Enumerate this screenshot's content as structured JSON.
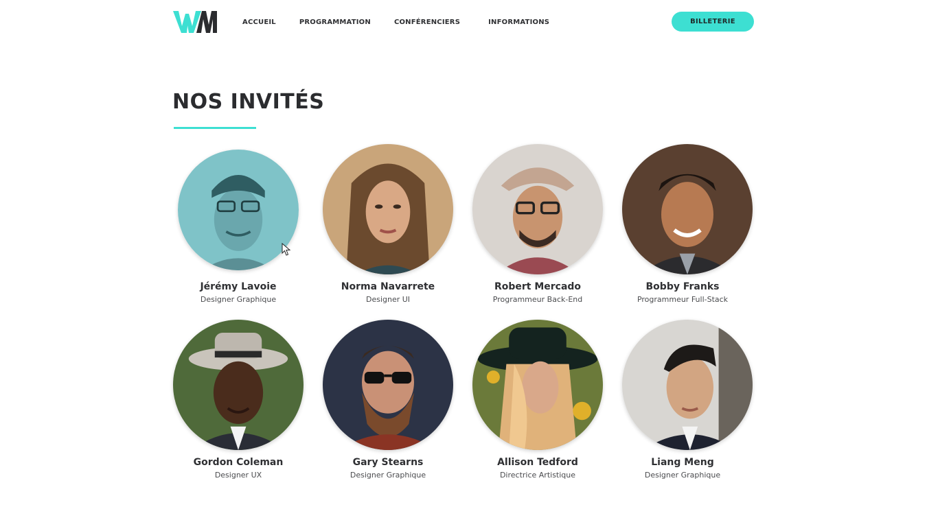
{
  "header": {
    "logo_text": "WM",
    "nav": [
      "ACCUEIL",
      "PROGRAMMATION",
      "CONFÉRENCIERS",
      "INFORMATIONS"
    ],
    "ticket_label": "BILLETERIE"
  },
  "section": {
    "title": "NOS INVITÉS"
  },
  "colors": {
    "accent": "#3ddfd2",
    "text": "#2f3033",
    "logo_dark": "#2b2c2f"
  },
  "guests": [
    {
      "name": "Jérémy Lavoie",
      "role": "Designer Graphique"
    },
    {
      "name": "Norma Navarrete",
      "role": "Designer UI"
    },
    {
      "name": "Robert Mercado",
      "role": "Programmeur Back-End"
    },
    {
      "name": "Bobby Franks",
      "role": "Programmeur Full-Stack"
    },
    {
      "name": "Gordon Coleman",
      "role": "Designer UX"
    },
    {
      "name": "Gary Stearns",
      "role": "Designer Graphique"
    },
    {
      "name": "Allison Tedford",
      "role": "Directrice Artistique"
    },
    {
      "name": "Liang Meng",
      "role": "Designer Graphique"
    }
  ]
}
